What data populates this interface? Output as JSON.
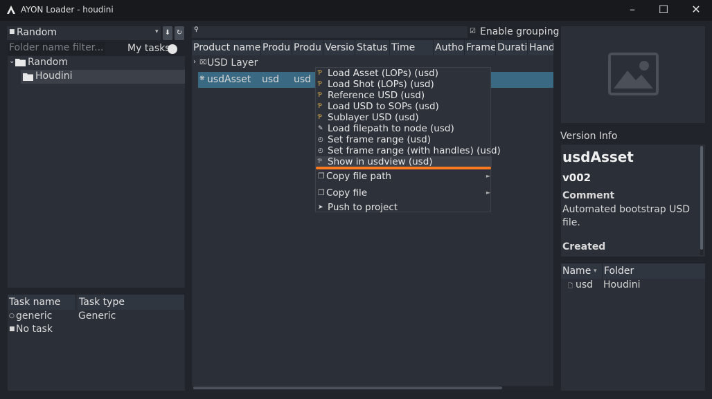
{
  "window": {
    "title": "AYON Loader - houdini"
  },
  "left": {
    "project": "Random",
    "folder_filter_placeholder": "Folder name filter...",
    "my_tasks_label": "My tasks",
    "tree": [
      {
        "label": "Random"
      },
      {
        "label": "Houdini"
      }
    ],
    "task_headers": [
      "Task name",
      "Task type"
    ],
    "tasks": [
      {
        "name": "generic",
        "type": "Generic"
      },
      {
        "name": "No task",
        "type": ""
      }
    ]
  },
  "center": {
    "enable_grouping_label": "Enable grouping",
    "columns": [
      "Product name",
      "Produ",
      "Produ",
      "Versio",
      "Status",
      "Time",
      "Autho",
      "Frame",
      "Durati",
      "Hand"
    ],
    "group": {
      "label": "USD Layer"
    },
    "row": {
      "name": "usdAsset",
      "type": "usd",
      "family": "usd"
    }
  },
  "context_menu": {
    "items": [
      {
        "label": "Load Asset (LOPs) (usd)",
        "icon": "houdini-icon"
      },
      {
        "label": "Load Shot (LOPs) (usd)",
        "icon": "houdini-icon"
      },
      {
        "label": "Reference USD (usd)",
        "icon": "houdini-icon"
      },
      {
        "label": "Load USD to SOPs (usd)",
        "icon": "houdini-icon"
      },
      {
        "label": "Sublayer USD (usd)",
        "icon": "houdini-icon"
      },
      {
        "label": "Load filepath to node (usd)",
        "icon": "link-icon"
      },
      {
        "label": "Set frame range (usd)",
        "icon": "clock-icon"
      },
      {
        "label": "Set frame range (with handles) (usd)",
        "icon": "clock-icon"
      },
      {
        "label": "Show in usdview (usd)",
        "icon": "houdini-icon"
      },
      {
        "label": "Copy file path",
        "icon": "copy-icon"
      },
      {
        "label": "Copy file",
        "icon": "copy-icon"
      },
      {
        "label": "Push to project",
        "icon": "play-icon"
      }
    ]
  },
  "right": {
    "version_info_label": "Version Info",
    "product_name": "usdAsset",
    "version": "v002",
    "comment_label": "Comment",
    "comment_text": "Automated bootstrap USD file.",
    "created_label": "Created",
    "rep_headers": [
      "Name",
      "Folder"
    ],
    "rep_rows": [
      {
        "name": "usd",
        "folder": "Houdini"
      }
    ]
  },
  "colors": {
    "accent_underline": "#ff7a1f",
    "selection": "#3a6a83",
    "hover": "#3b4049"
  }
}
